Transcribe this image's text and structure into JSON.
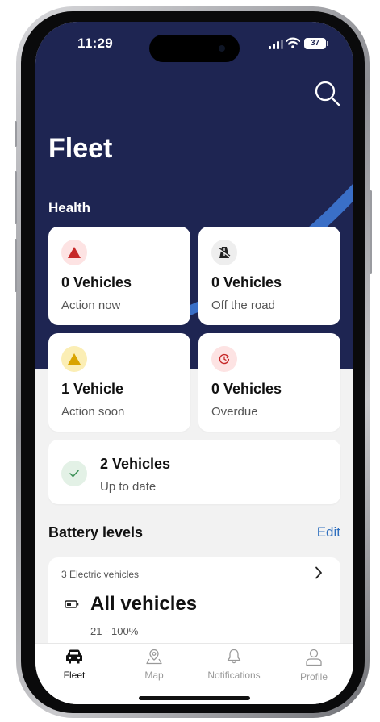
{
  "status_bar": {
    "time": "11:29",
    "battery": "37"
  },
  "header": {
    "title": "Fleet",
    "section": "Health"
  },
  "health_cards": [
    {
      "count": "0 Vehicles",
      "label": "Action now",
      "icon": "warning-red-icon"
    },
    {
      "count": "0 Vehicles",
      "label": "Off the road",
      "icon": "road-off-icon"
    },
    {
      "count": "1 Vehicle",
      "label": "Action soon",
      "icon": "warning-yellow-icon"
    },
    {
      "count": "0 Vehicles",
      "label": "Overdue",
      "icon": "overdue-clock-icon"
    },
    {
      "count": "2 Vehicles",
      "label": "Up to date",
      "icon": "check-icon"
    }
  ],
  "battery": {
    "title": "Battery levels",
    "edit_label": "Edit",
    "count": "3 Electric vehicles",
    "filter": "All vehicles",
    "range": "21 - 100%"
  },
  "tabs": [
    {
      "label": "Fleet",
      "icon": "car-icon",
      "active": true
    },
    {
      "label": "Map",
      "icon": "map-pin-icon",
      "active": false
    },
    {
      "label": "Notifications",
      "icon": "bell-icon",
      "active": false
    },
    {
      "label": "Profile",
      "icon": "person-icon",
      "active": false
    }
  ],
  "colors": {
    "hero": "#1e2552",
    "accent_blue": "#3a6fc7",
    "link": "#2f6fbf",
    "red": "#c62828",
    "yellow": "#d9a400",
    "green": "#3a8f55"
  }
}
